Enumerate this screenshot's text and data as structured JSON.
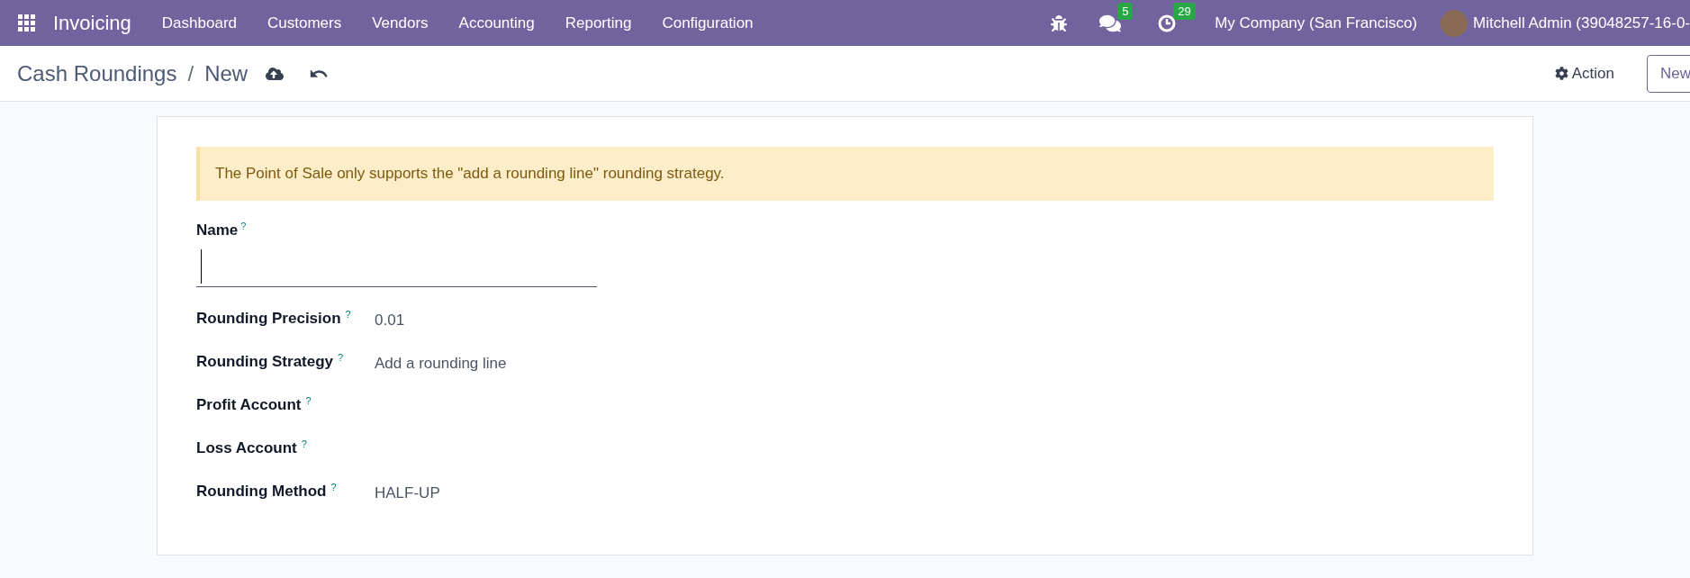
{
  "navbar": {
    "app_name": "Invoicing",
    "menu": [
      "Dashboard",
      "Customers",
      "Vendors",
      "Accounting",
      "Reporting",
      "Configuration"
    ],
    "messages_badge": "5",
    "activities_badge": "29",
    "company": "My Company (San Francisco)",
    "user": "Mitchell Admin (39048257-16-0-"
  },
  "control_panel": {
    "breadcrumb": "Cash Roundings",
    "separator": "/",
    "current": "New",
    "action": "Action",
    "new_button": "New"
  },
  "alert": "The Point of Sale only supports the \"add a rounding line\" rounding strategy.",
  "name_field": {
    "label": "Name",
    "help": "?"
  },
  "fields": [
    {
      "label": "Rounding Precision",
      "help": "?",
      "value": "0.01"
    },
    {
      "label": "Rounding Strategy",
      "help": "?",
      "value": "Add a rounding line"
    },
    {
      "label": "Profit Account",
      "help": "?"
    },
    {
      "label": "Loss Account",
      "help": "?"
    },
    {
      "label": "Rounding Method",
      "help": "?",
      "value": "HALF-UP"
    }
  ]
}
